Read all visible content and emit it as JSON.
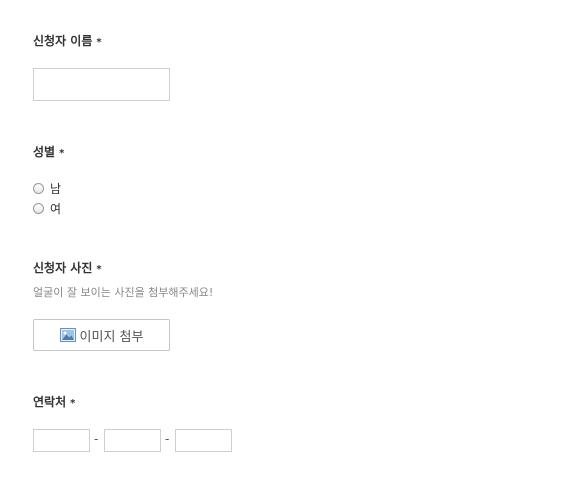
{
  "form": {
    "name": {
      "label": "신청자 이름",
      "required_mark": "*",
      "value": ""
    },
    "gender": {
      "label": "성별",
      "required_mark": "*",
      "options": [
        "남",
        "여"
      ],
      "selected": null
    },
    "photo": {
      "label": "신청자 사진",
      "required_mark": "*",
      "help_text": "얼굴이 잘 보이는 사진을 첨부해주세요!",
      "button_label": "이미지 첨부",
      "button_icon": "image-icon"
    },
    "phone": {
      "label": "연락처",
      "required_mark": "*",
      "separator": "-",
      "parts": [
        "",
        "",
        ""
      ]
    }
  }
}
